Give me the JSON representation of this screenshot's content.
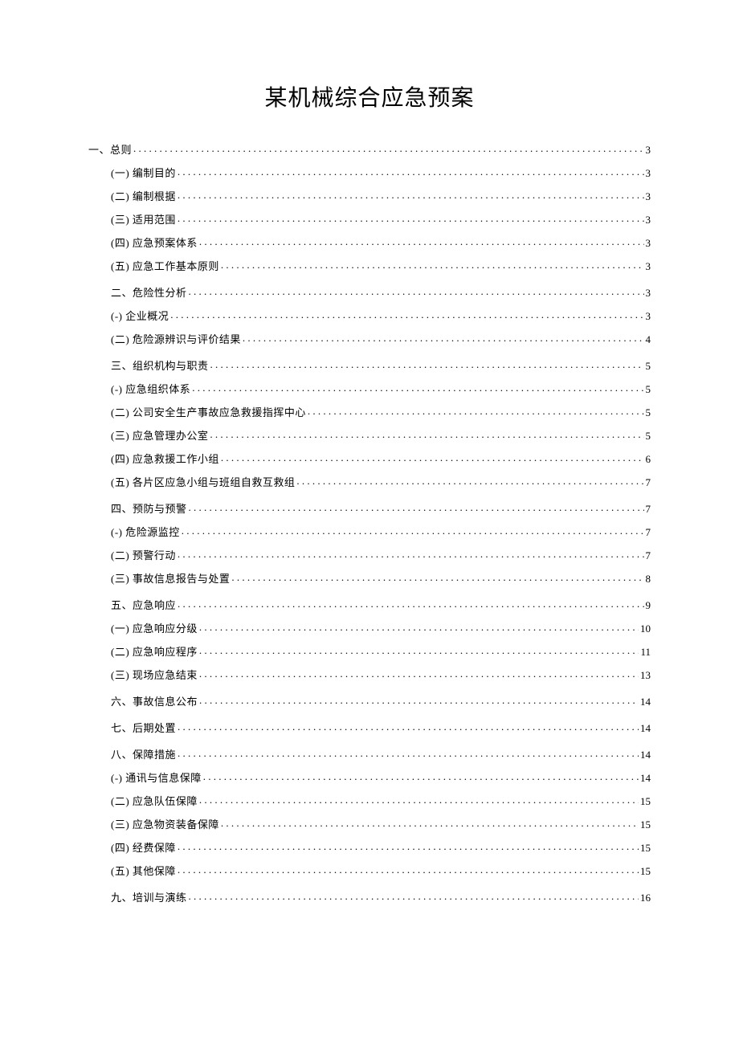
{
  "title": "某机械综合应急预案",
  "toc": [
    {
      "level": 1,
      "label": "一、总则",
      "page": "3",
      "first": true
    },
    {
      "level": 3,
      "label": "(一) 编制目的",
      "page": "3"
    },
    {
      "level": 3,
      "label": "(二) 编制根据",
      "page": "3"
    },
    {
      "level": 3,
      "label": "(三) 适用范围",
      "page": "3"
    },
    {
      "level": 3,
      "label": "(四) 应急预案体系",
      "page": "3"
    },
    {
      "level": 3,
      "label": "(五) 应急工作基本原则",
      "page": "3"
    },
    {
      "level": 2,
      "label": "二、危险性分析",
      "page": "3"
    },
    {
      "level": 3,
      "label": "(-) 企业概况",
      "page": "3"
    },
    {
      "level": 3,
      "label": "(二) 危险源辨识与评价结果",
      "page": "4"
    },
    {
      "level": 2,
      "label": "三、组织机构与职责",
      "page": "5"
    },
    {
      "level": 3,
      "label": "(-) 应急组织体系",
      "page": "5"
    },
    {
      "level": 3,
      "label": "(二) 公司安全生产事故应急救援指挥中心",
      "page": "5"
    },
    {
      "level": 3,
      "label": "(三) 应急管理办公室",
      "page": "5"
    },
    {
      "level": 3,
      "label": "(四) 应急救援工作小组",
      "page": "6"
    },
    {
      "level": 3,
      "label": "(五) 各片区应急小组与班组自救互救组",
      "page": "7"
    },
    {
      "level": 2,
      "label": "四、预防与预警",
      "page": "7"
    },
    {
      "level": 3,
      "label": "(-) 危险源监控",
      "page": "7"
    },
    {
      "level": 3,
      "label": "(二) 预警行动",
      "page": "7"
    },
    {
      "level": 3,
      "label": "(三) 事故信息报告与处置",
      "page": "8"
    },
    {
      "level": 2,
      "label": "五、应急响应",
      "page": "9"
    },
    {
      "level": 3,
      "label": "(一) 应急响应分级",
      "page": "10"
    },
    {
      "level": 3,
      "label": "(二) 应急响应程序",
      "page": "11"
    },
    {
      "level": 3,
      "label": "(三) 现场应急结束",
      "page": "13"
    },
    {
      "level": 2,
      "label": "六、事故信息公布",
      "page": "14"
    },
    {
      "level": 2,
      "label": "七、后期处置",
      "page": "14"
    },
    {
      "level": 2,
      "label": "八、保障措施",
      "page": "14"
    },
    {
      "level": 3,
      "label": "(-) 通讯与信息保障",
      "page": "14"
    },
    {
      "level": 3,
      "label": "(二) 应急队伍保障",
      "page": "15"
    },
    {
      "level": 3,
      "label": "(三) 应急物资装备保障",
      "page": "15"
    },
    {
      "level": 3,
      "label": "(四) 经费保障",
      "page": "15"
    },
    {
      "level": 3,
      "label": "(五) 其他保障",
      "page": "15"
    },
    {
      "level": 2,
      "label": "九、培训与演练",
      "page": "16"
    }
  ]
}
